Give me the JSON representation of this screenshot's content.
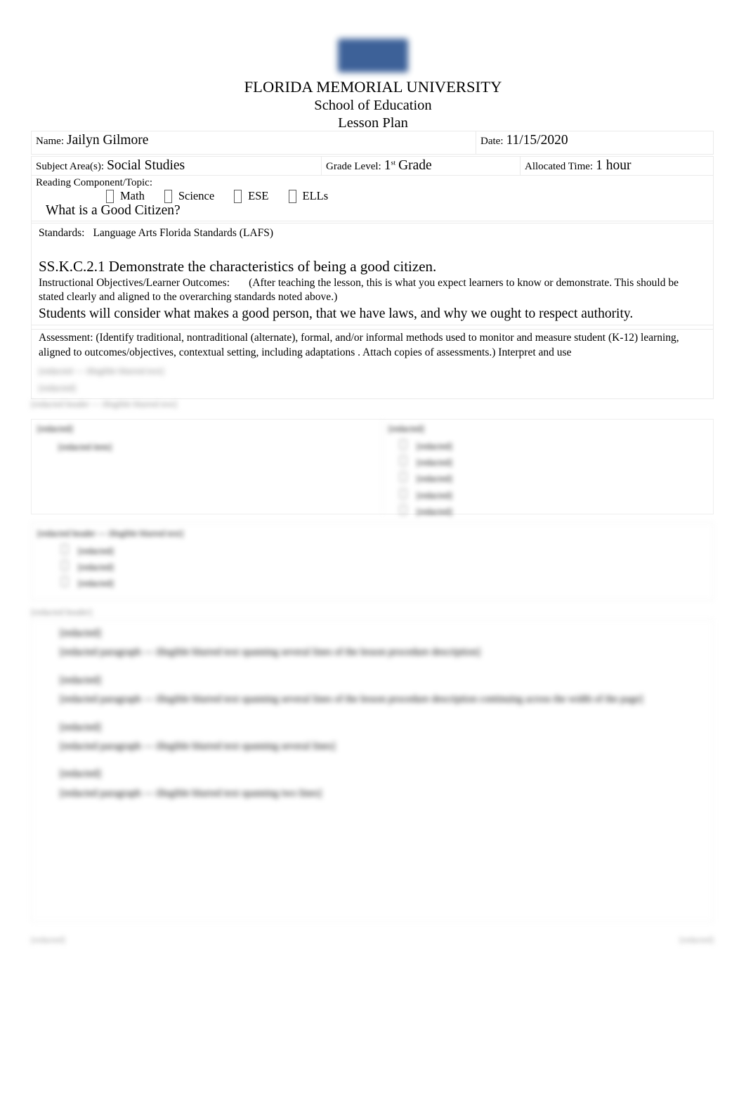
{
  "document": {
    "institution": "FLORIDA MEMORIAL UNIVERSITY",
    "school": "School of Education",
    "form_title": "Lesson Plan",
    "logo_color": "#2d5490"
  },
  "header": {
    "name_label": "Name:",
    "name_value": "Jailyn Gilmore",
    "date_label": "Date:",
    "date_value": "11/15/2020",
    "subject_label": "Subject Area(s):",
    "subject_value": "Social Studies",
    "grade_label": "Grade Level:",
    "grade_value_num": "1",
    "grade_value_sup": "st",
    "grade_value_rest": "Grade",
    "time_label": "Allocated Time:",
    "time_value": "1 hour",
    "reading_component_label": "Reading Component/Topic:",
    "reading_component_value": "What is a Good Citizen?",
    "checkboxes": [
      {
        "label": "Math",
        "checked": false
      },
      {
        "label": "Science",
        "checked": false
      },
      {
        "label": "ESE",
        "checked": false
      },
      {
        "label": "ELLs",
        "checked": false
      }
    ]
  },
  "standards": {
    "label": "Standards:",
    "value": "Language Arts Florida Standards (LAFS)",
    "code_text": "SS.K.C.2.1 Demonstrate the characteristics of being a good citizen.",
    "objectives_label": "Instructional Objectives/Learner Outcomes:",
    "objectives_hint": "(After teaching the lesson, this is what you expect learners to know or demonstrate.  This should be stated clearly and aligned to the overarching standards noted above.)",
    "objectives_value": "Students will consider what makes a good person, that we have laws, and why we ought to respect authority."
  },
  "assessment": {
    "text": "Assessment:  (Identify traditional, nontraditional (alternate), formal, and/or informal methods used to monitor and measure student (K-12) learning, aligned to outcomes/objectives, contextual setting, including adaptations .  Attach copies of assessments.) Interpret and use",
    "redacted_line_1": "[redacted — illegible blurred text]",
    "redacted_line_2": "[redacted]"
  },
  "materials": {
    "header_redacted": "[redacted header — illegible blurred text]",
    "left_column": {
      "title_redacted": "[redacted]",
      "item_redacted": "[redacted item]"
    },
    "right_column": {
      "title_redacted": "[redacted]",
      "items_redacted": [
        "[redacted]",
        "[redacted]",
        "[redacted]",
        "[redacted]",
        "[redacted]"
      ]
    }
  },
  "vocabulary": {
    "header_redacted": "[redacted header — illegible blurred text]",
    "items_redacted": [
      "[redacted]",
      "[redacted]",
      "[redacted]"
    ]
  },
  "procedures": {
    "header_redacted": "[redacted header]",
    "blocks_redacted": [
      {
        "heading": "[redacted]",
        "body": "[redacted paragraph — illegible blurred text spanning several lines of the lesson procedure description]"
      },
      {
        "heading": "[redacted]",
        "body": "[redacted paragraph — illegible blurred text spanning several lines of the lesson procedure description continuing across the width of the page]"
      },
      {
        "heading": "[redacted]",
        "body": "[redacted paragraph — illegible blurred text spanning several lines]"
      },
      {
        "heading": "[redacted]",
        "body": "[redacted paragraph — illegible blurred text spanning two lines]"
      }
    ]
  },
  "footer": {
    "left_redacted": "[redacted]",
    "right_redacted": "[redacted]"
  }
}
